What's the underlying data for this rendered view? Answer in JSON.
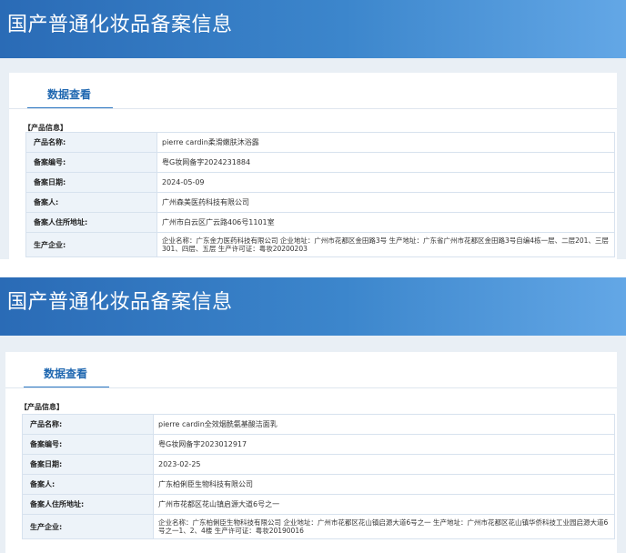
{
  "records": [
    {
      "header_title": "国产普通化妆品备案信息",
      "tab_label": "数据查看",
      "section_label": "【产品信息】",
      "rows": [
        {
          "label": "产品名称:",
          "value": "pierre cardin柔滑嫩肤沐浴露"
        },
        {
          "label": "备案编号:",
          "value": "粤G妆网备字2024231884"
        },
        {
          "label": "备案日期:",
          "value": "2024-05-09"
        },
        {
          "label": "备案人:",
          "value": "广州森美医药科技有限公司"
        },
        {
          "label": "备案人住所地址:",
          "value": "广州市白云区广云路406号1101室"
        },
        {
          "label": "生产企业:",
          "value": "企业名称：广东金力医药科技有限公司 企业地址：广州市花都区金田路3号 生产地址：广东省广州市花都区金田路3号自编4栋一层、二层201、三层301、四层、五层 生产许可证：粤妆20200203"
        }
      ]
    },
    {
      "header_title": "国产普通化妆品备案信息",
      "tab_label": "数据查看",
      "section_label": "【产品信息】",
      "rows": [
        {
          "label": "产品名称:",
          "value": "pierre cardin全效烟酰氨基酸洁面乳"
        },
        {
          "label": "备案编号:",
          "value": "粤G妆网备字2023012917"
        },
        {
          "label": "备案日期:",
          "value": "2023-02-25"
        },
        {
          "label": "备案人:",
          "value": "广东柏俐臣生物科技有限公司"
        },
        {
          "label": "备案人住所地址:",
          "value": "广州市花都区花山镇启源大道6号之一"
        },
        {
          "label": "生产企业:",
          "value": "企业名称：广东柏俐臣生物科技有限公司 企业地址：广州市花都区花山镇启源大道6号之一 生产地址：广州市花都区花山镇华侨科技工业园启源大道6号之一1、2、4楼 生产许可证：粤妆20190016"
        }
      ]
    }
  ]
}
